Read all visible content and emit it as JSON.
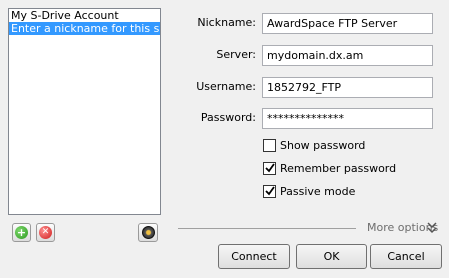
{
  "accounts": {
    "items": [
      {
        "label": "My S-Drive Account"
      },
      {
        "label": "Enter a nickname for this server"
      }
    ]
  },
  "form": {
    "nickname": {
      "label": "Nickname:",
      "value": "AwardSpace FTP Server"
    },
    "server": {
      "label": "Server:",
      "value": "mydomain.dx.am"
    },
    "username": {
      "label": "Username:",
      "value": "1852792_FTP"
    },
    "password": {
      "label": "Password:",
      "value": "**************"
    }
  },
  "options": {
    "show_password": {
      "label": "Show password",
      "checked": false
    },
    "remember_password": {
      "label": "Remember password",
      "checked": true
    },
    "passive_mode": {
      "label": "Passive mode",
      "checked": true
    }
  },
  "more_options_label": "More options",
  "buttons": {
    "connect": "Connect",
    "ok": "OK",
    "cancel": "Cancel"
  },
  "icons": {
    "add": "plus-icon",
    "remove": "x-icon",
    "settings": "gear-icon",
    "more": "double-chevron-down-icon"
  }
}
